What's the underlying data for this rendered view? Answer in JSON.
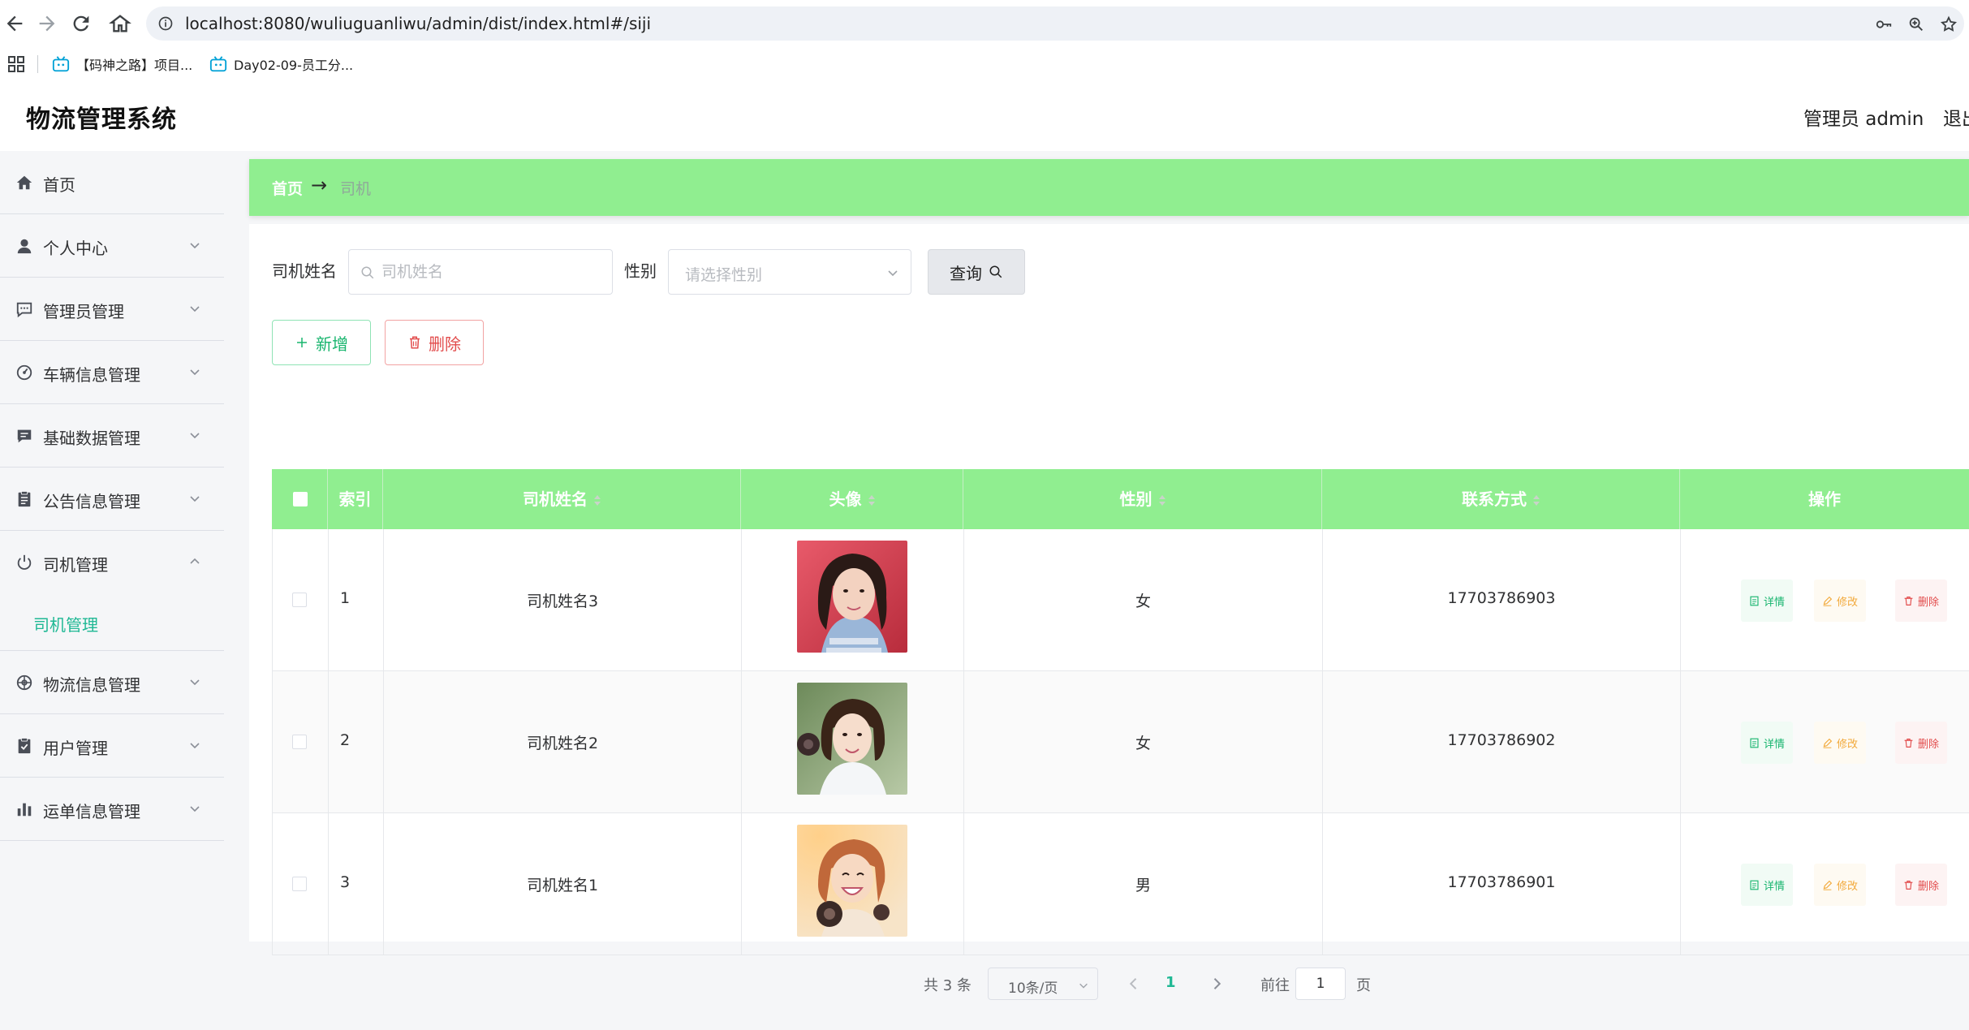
{
  "browser": {
    "url": "localhost:8080/wuliuguanliwu/admin/dist/index.html#/siji",
    "bookmarks": [
      {
        "label": "【码神之路】项目..."
      },
      {
        "label": "Day02-09-员工分..."
      }
    ]
  },
  "header": {
    "title": "物流管理系统",
    "admin_label": "管理员 admin",
    "logout": "退出"
  },
  "sidebar": {
    "items": [
      {
        "label": "首页",
        "icon": "home-icon"
      },
      {
        "label": "个人中心",
        "icon": "user-icon"
      },
      {
        "label": "管理员管理",
        "icon": "message-icon"
      },
      {
        "label": "车辆信息管理",
        "icon": "gauge-icon"
      },
      {
        "label": "基础数据管理",
        "icon": "chat-icon"
      },
      {
        "label": "公告信息管理",
        "icon": "clipboard-icon"
      },
      {
        "label": "司机管理",
        "icon": "power-icon"
      },
      {
        "label": "物流信息管理",
        "icon": "compass-icon"
      },
      {
        "label": "用户管理",
        "icon": "check-clipboard-icon"
      },
      {
        "label": "运单信息管理",
        "icon": "bar-chart-icon"
      }
    ],
    "submenu_driver": "司机管理"
  },
  "breadcrumb": {
    "home": "首页",
    "arrow": "→",
    "current": "司机"
  },
  "search": {
    "name_label": "司机姓名",
    "name_placeholder": "司机姓名",
    "gender_label": "性别",
    "gender_placeholder": "请选择性别",
    "search_button": "查询"
  },
  "actions": {
    "add": "新增",
    "delete": "删除"
  },
  "table": {
    "headers": {
      "index": "索引",
      "name": "司机姓名",
      "avatar": "头像",
      "gender": "性别",
      "phone": "联系方式",
      "operations": "操作"
    },
    "rows": [
      {
        "index": "1",
        "name": "司机姓名3",
        "gender": "女",
        "phone": "17703786903"
      },
      {
        "index": "2",
        "name": "司机姓名2",
        "gender": "女",
        "phone": "17703786902"
      },
      {
        "index": "3",
        "name": "司机姓名1",
        "gender": "男",
        "phone": "17703786901"
      }
    ],
    "row_actions": {
      "detail": "详情",
      "edit": "修改",
      "delete": "删除"
    }
  },
  "pagination": {
    "total": "共 3 条",
    "page_size": "10条/页",
    "current_page": "1",
    "goto_label": "前往",
    "goto_value": "1",
    "page_suffix": "页"
  },
  "colors": {
    "accent_green": "#90ee90",
    "primary": "#1fb894",
    "danger": "#e24c4c",
    "warning": "#f2a93b"
  }
}
